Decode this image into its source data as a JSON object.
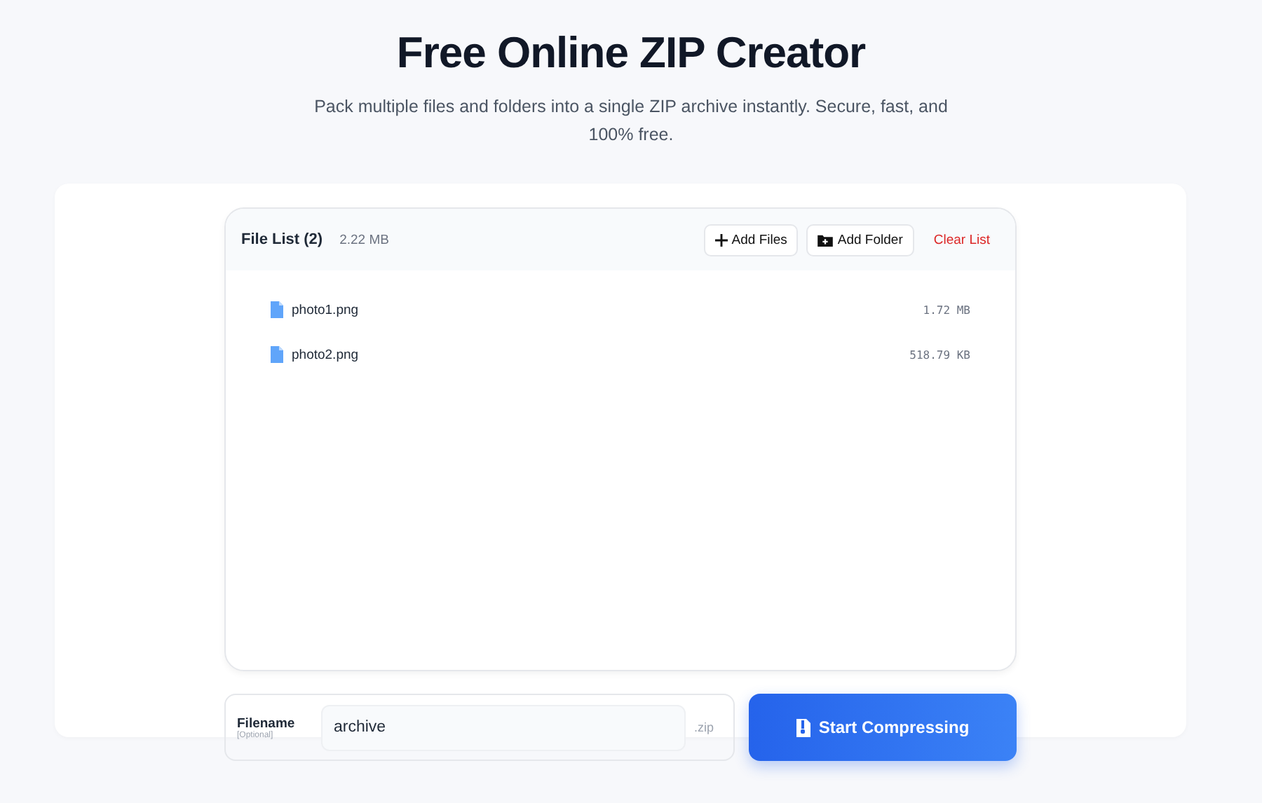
{
  "header": {
    "title": "Free Online ZIP Creator",
    "subtitle": "Pack multiple files and folders into a single ZIP archive instantly. Secure, fast, and 100% free."
  },
  "file_list": {
    "title": "File List (2)",
    "total_size": "2.22 MB",
    "actions": [
      {
        "kind": "add-files",
        "label": "Add Files"
      },
      {
        "kind": "add-folder",
        "label": "Add Folder"
      },
      {
        "kind": "clear",
        "label": "Clear List"
      }
    ],
    "files": [
      {
        "name": "photo1.png",
        "size": "1.72 MB"
      },
      {
        "name": "photo2.png",
        "size": "518.79 KB"
      }
    ]
  },
  "filename": {
    "label": "Filename",
    "hint": "[Optional]",
    "value": "archive",
    "extension": ".zip"
  },
  "start_button": {
    "label": "Start Compressing"
  }
}
